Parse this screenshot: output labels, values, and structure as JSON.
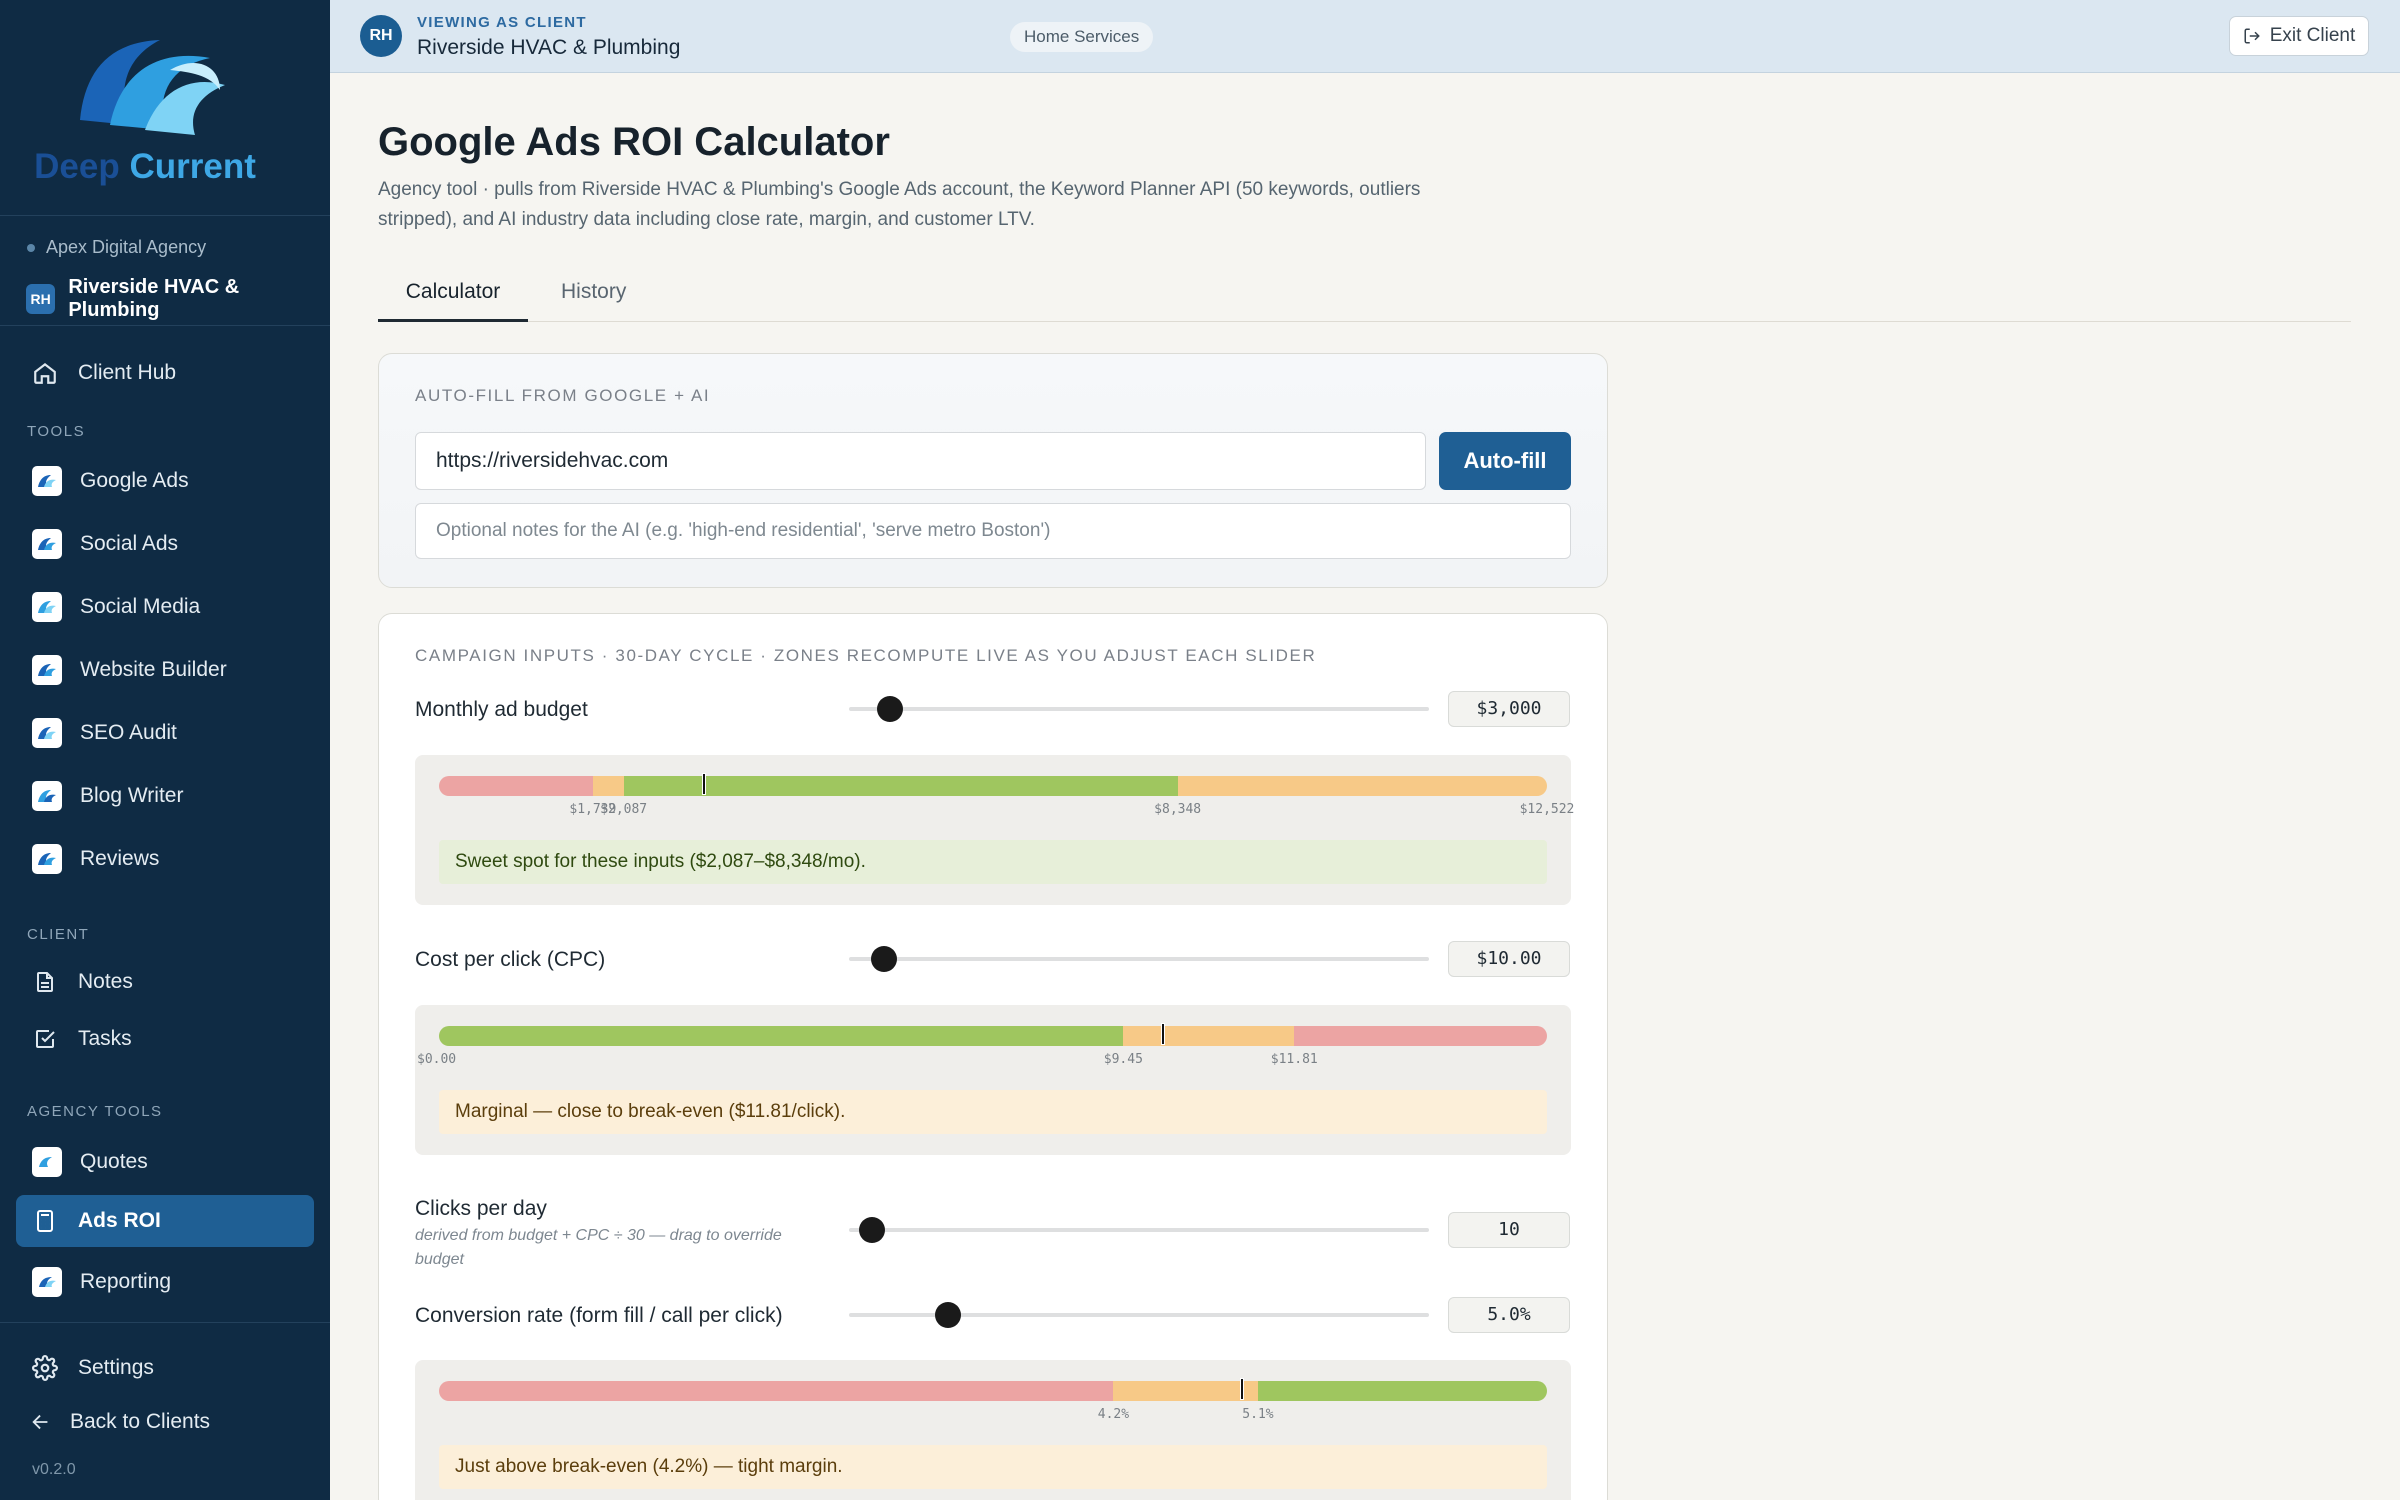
{
  "brand": {
    "word1": "Deep",
    "word2": "Current"
  },
  "sidebar": {
    "agency": "Apex Digital Agency",
    "client": {
      "initials": "RH",
      "name": "Riverside HVAC & Plumbing"
    },
    "client_hub": "Client Hub",
    "sections": {
      "tools": "TOOLS",
      "client": "CLIENT",
      "agency_tools": "AGENCY TOOLS"
    },
    "tools": [
      "Google Ads",
      "Social Ads",
      "Social Media",
      "Website Builder",
      "SEO Audit",
      "Blog Writer",
      "Reviews"
    ],
    "client_items": [
      "Notes",
      "Tasks"
    ],
    "agency_items": [
      "Quotes",
      "Ads ROI",
      "Reporting"
    ],
    "settings": "Settings",
    "back": "Back to Clients",
    "version": "v0.2.0"
  },
  "topbar": {
    "initials": "RH",
    "label": "VIEWING AS CLIENT",
    "name": "Riverside HVAC & Plumbing",
    "tag": "Home Services",
    "exit": "Exit Client"
  },
  "page": {
    "title": "Google Ads ROI Calculator",
    "description": "Agency tool · pulls from Riverside HVAC & Plumbing's Google Ads account, the Keyword Planner API (50 keywords, outliers stripped), and AI industry data including close rate, margin, and customer LTV.",
    "tabs": [
      "Calculator",
      "History"
    ]
  },
  "autofill": {
    "caption": "AUTO-FILL FROM GOOGLE + AI",
    "url_value": "https://riversidehvac.com",
    "button": "Auto-fill",
    "notes_placeholder": "Optional notes for the AI (e.g. 'high-end residential', 'serve metro Boston')"
  },
  "inputs": {
    "caption": "CAMPAIGN INPUTS · 30-DAY CYCLE · ZONES RECOMPUTE LIVE AS YOU ADJUST EACH SLIDER",
    "budget": {
      "label": "Monthly ad budget",
      "value": "$3,000",
      "slider_pct": 7,
      "zone": {
        "max": 12522,
        "marker": 3000,
        "segments": [
          {
            "from": 0,
            "to": 1739,
            "color": "#eca4a3"
          },
          {
            "from": 1739,
            "to": 2087,
            "color": "#f7c987"
          },
          {
            "from": 2087,
            "to": 8348,
            "color": "#9fc65f"
          },
          {
            "from": 8348,
            "to": 12522,
            "color": "#f7c987"
          }
        ],
        "ticks": [
          {
            "v": 1739,
            "label": "$1,739"
          },
          {
            "v": 2087,
            "label": "$2,087"
          },
          {
            "v": 8348,
            "label": "$8,348"
          },
          {
            "v": 12522,
            "label": "$12,522"
          }
        ]
      },
      "message": "Sweet spot for these inputs ($2,087–$8,348/mo)."
    },
    "cpc": {
      "label": "Cost per click (CPC)",
      "value": "$10.00",
      "slider_pct": 6,
      "zone": {
        "max": 15.3,
        "marker": 10.0,
        "segments": [
          {
            "from": 0,
            "to": 9.45,
            "color": "#9fc65f"
          },
          {
            "from": 9.45,
            "to": 11.81,
            "color": "#f7c987"
          },
          {
            "from": 11.81,
            "to": 15.3,
            "color": "#eca4a3"
          }
        ],
        "ticks": [
          {
            "v": 0,
            "label": "$0.00"
          },
          {
            "v": 9.45,
            "label": "$9.45"
          },
          {
            "v": 11.81,
            "label": "$11.81"
          }
        ]
      },
      "message": "Marginal — close to break-even ($11.81/click)."
    },
    "clicks": {
      "label": "Clicks per day",
      "sub": "derived from budget + CPC ÷ 30 — drag to override budget",
      "value": "10",
      "slider_pct": 4
    },
    "conversion": {
      "label": "Conversion rate (form fill / call per click)",
      "value": "5.0%",
      "slider_pct": 17,
      "zone": {
        "max": 6.9,
        "marker": 5.0,
        "segments": [
          {
            "from": 0,
            "to": 4.2,
            "color": "#eca4a3"
          },
          {
            "from": 4.2,
            "to": 5.1,
            "color": "#f7c987"
          },
          {
            "from": 5.1,
            "to": 6.9,
            "color": "#9fc65f"
          }
        ],
        "ticks": [
          {
            "v": 4.2,
            "label": "4.2%"
          },
          {
            "v": 5.1,
            "label": "5.1%"
          }
        ]
      },
      "message": "Just above break-even (4.2%) — tight margin."
    }
  }
}
